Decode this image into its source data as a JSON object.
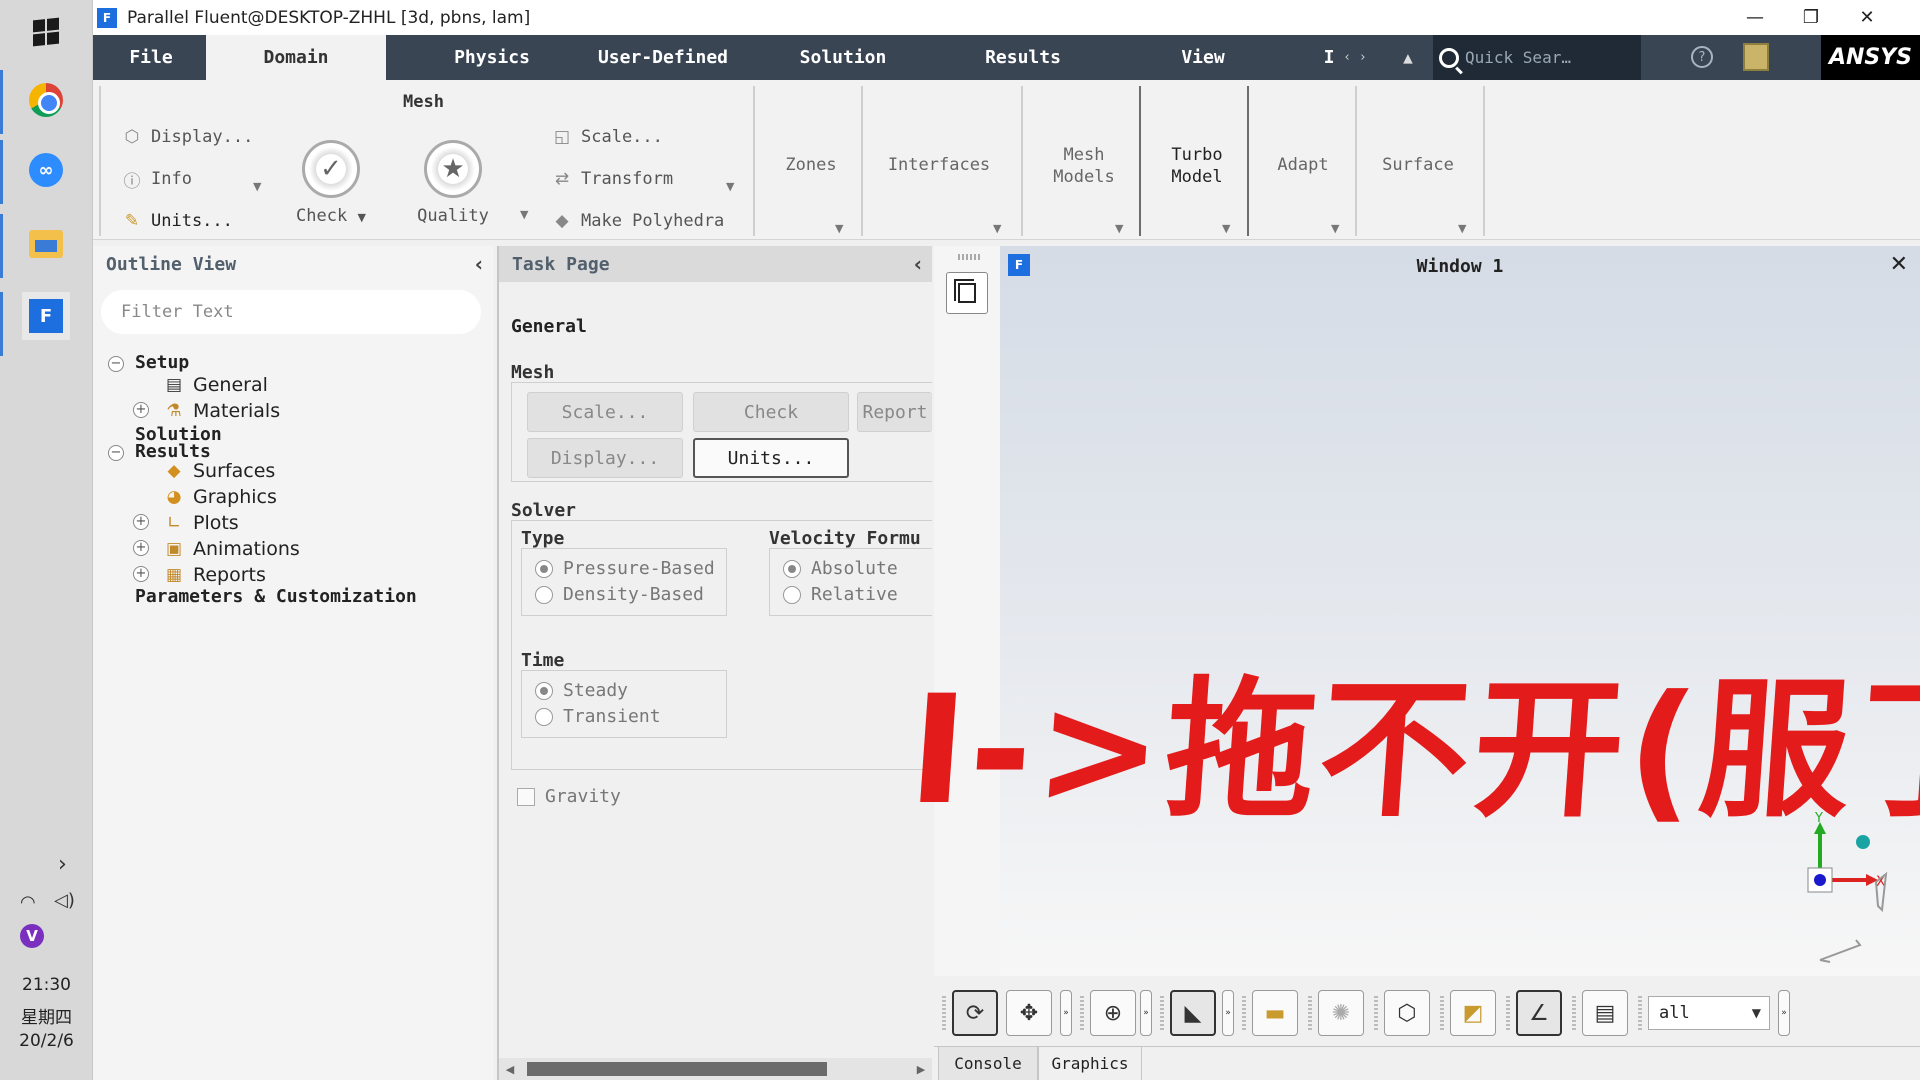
{
  "taskbar": {
    "clock_time": "21:30",
    "clock_day": "星期四",
    "clock_date": "20/2/6"
  },
  "titlebar": {
    "title": "Parallel Fluent@DESKTOP-ZHHL  [3d, pbns, lam]",
    "app_icon_letter": "F"
  },
  "tabs": [
    {
      "label": "File",
      "active": false
    },
    {
      "label": "Domain",
      "active": true
    },
    {
      "label": "Physics",
      "active": false
    },
    {
      "label": "User-Defined",
      "active": false
    },
    {
      "label": "Solution",
      "active": false
    },
    {
      "label": "Results",
      "active": false
    },
    {
      "label": "View",
      "active": false
    }
  ],
  "tab_overflow_label": "I",
  "quick_search": {
    "placeholder": "Quick Sear…"
  },
  "brand": {
    "logo": "ANSYS"
  },
  "ribbon": {
    "mesh_group_title": "Mesh",
    "display": "Display...",
    "info": "Info",
    "units": "Units...",
    "check": "Check",
    "quality": "Quality",
    "scale": "Scale...",
    "transform": "Transform",
    "make_polyhedra": "Make Polyhedra",
    "zones": "Zones",
    "interfaces": "Interfaces",
    "mesh_models_1": "Mesh",
    "mesh_models_2": "Models",
    "turbo_model_1": "Turbo",
    "turbo_model_2": "Model",
    "adapt": "Adapt",
    "surface": "Surface"
  },
  "outline": {
    "title": "Outline View",
    "filter_placeholder": "Filter Text",
    "items": [
      {
        "label": "Setup"
      },
      {
        "label": "General"
      },
      {
        "label": "Materials"
      },
      {
        "label": "Solution"
      },
      {
        "label": "Results"
      },
      {
        "label": "Surfaces"
      },
      {
        "label": "Graphics"
      },
      {
        "label": "Plots"
      },
      {
        "label": "Animations"
      },
      {
        "label": "Reports"
      },
      {
        "label": "Parameters & Customization"
      }
    ]
  },
  "taskpage": {
    "title": "Task Page",
    "section": "General",
    "mesh_label": "Mesh",
    "btn_scale": "Scale...",
    "btn_check": "Check",
    "btn_report": "Report",
    "btn_display": "Display...",
    "btn_units": "Units...",
    "solver_label": "Solver",
    "type_label": "Type",
    "type_options": [
      "Pressure-Based",
      "Density-Based"
    ],
    "velocity_label": "Velocity Formu",
    "velocity_options": [
      "Absolute",
      "Relative"
    ],
    "time_label": "Time",
    "time_options": [
      "Steady",
      "Transient"
    ],
    "gravity": "Gravity"
  },
  "viewport": {
    "title": "Window 1",
    "annotation": "I->拖不开(服了)",
    "axis_x": "X",
    "axis_y": "Y"
  },
  "gfx_toolbar": {
    "select_value": "all"
  },
  "console_tabs": [
    "Console",
    "Graphics"
  ],
  "colors": {
    "tab_bar": "#3a4554",
    "annotation": "#e41b1b",
    "fluent_blue": "#1d6fe0"
  }
}
